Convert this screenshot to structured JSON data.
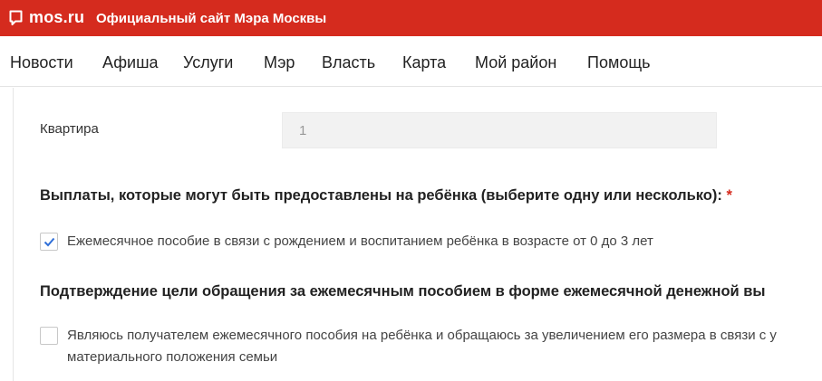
{
  "header": {
    "logo_text": "mos.ru",
    "site_title": "Официальный сайт Мэра Москвы",
    "bg_color": "#d52b1e"
  },
  "nav": {
    "items": [
      "Новости",
      "Афиша",
      "Услуги",
      "Мэр",
      "Власть",
      "Карта",
      "Мой район",
      "Помощь"
    ]
  },
  "form": {
    "apartment": {
      "label": "Квартира",
      "value": "1"
    },
    "payments": {
      "title": "Выплаты, которые могут быть предоставлены на ребёнка (выберите одну или несколько):",
      "required_mark": "*",
      "option_label": "Ежемесячное пособие в связи с рождением и воспитанием ребёнка в возрасте от 0 до 3 лет",
      "option_checked": true
    },
    "confirmation": {
      "title": "Подтверждение цели обращения за ежемесячным пособием в форме ежемесячной денежной вы",
      "option_line1": "Являюсь получателем ежемесячного пособия на ребёнка и обращаюсь за увеличением его размера в связи с у",
      "option_line2": "материального положения семьи",
      "option_checked": false
    }
  }
}
